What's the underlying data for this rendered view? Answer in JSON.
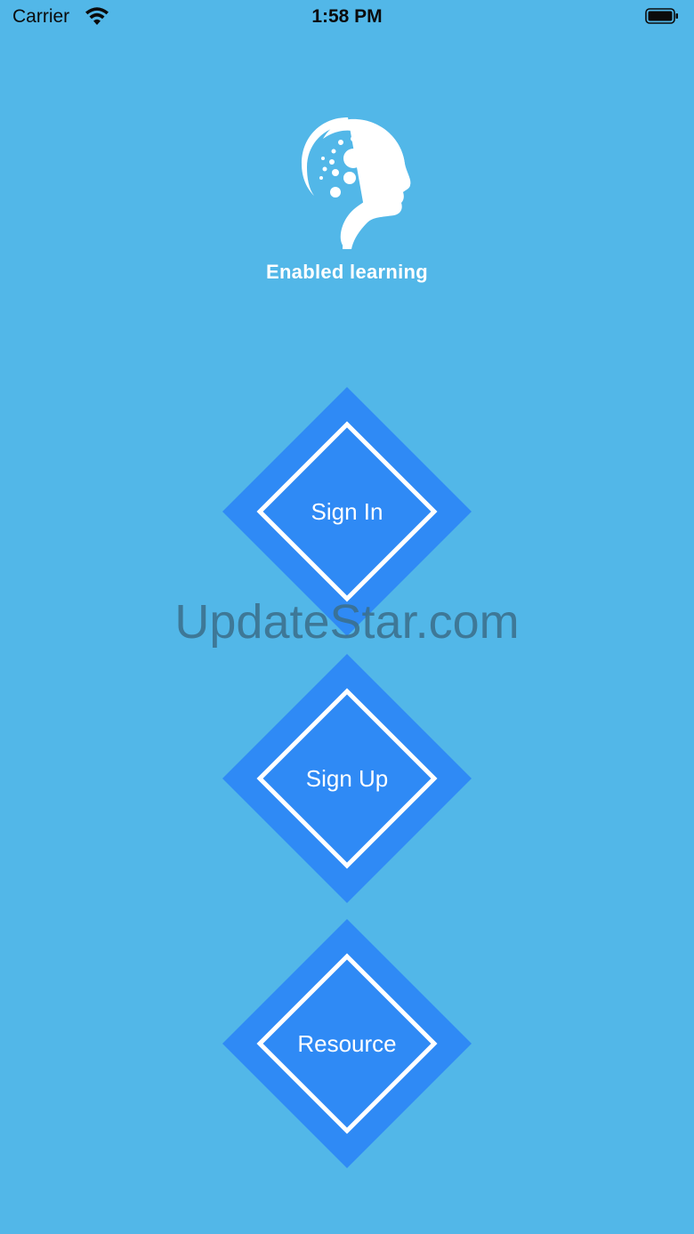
{
  "status_bar": {
    "carrier": "Carrier",
    "time": "1:58 PM"
  },
  "app": {
    "name": "Enabled learning"
  },
  "buttons": {
    "sign_in": "Sign In",
    "sign_up": "Sign Up",
    "resource": "Resource"
  },
  "watermark": "UpdateStar.com",
  "colors": {
    "background": "#52b7e8",
    "button_fill": "#2f8af5",
    "outline": "#ffffff"
  }
}
